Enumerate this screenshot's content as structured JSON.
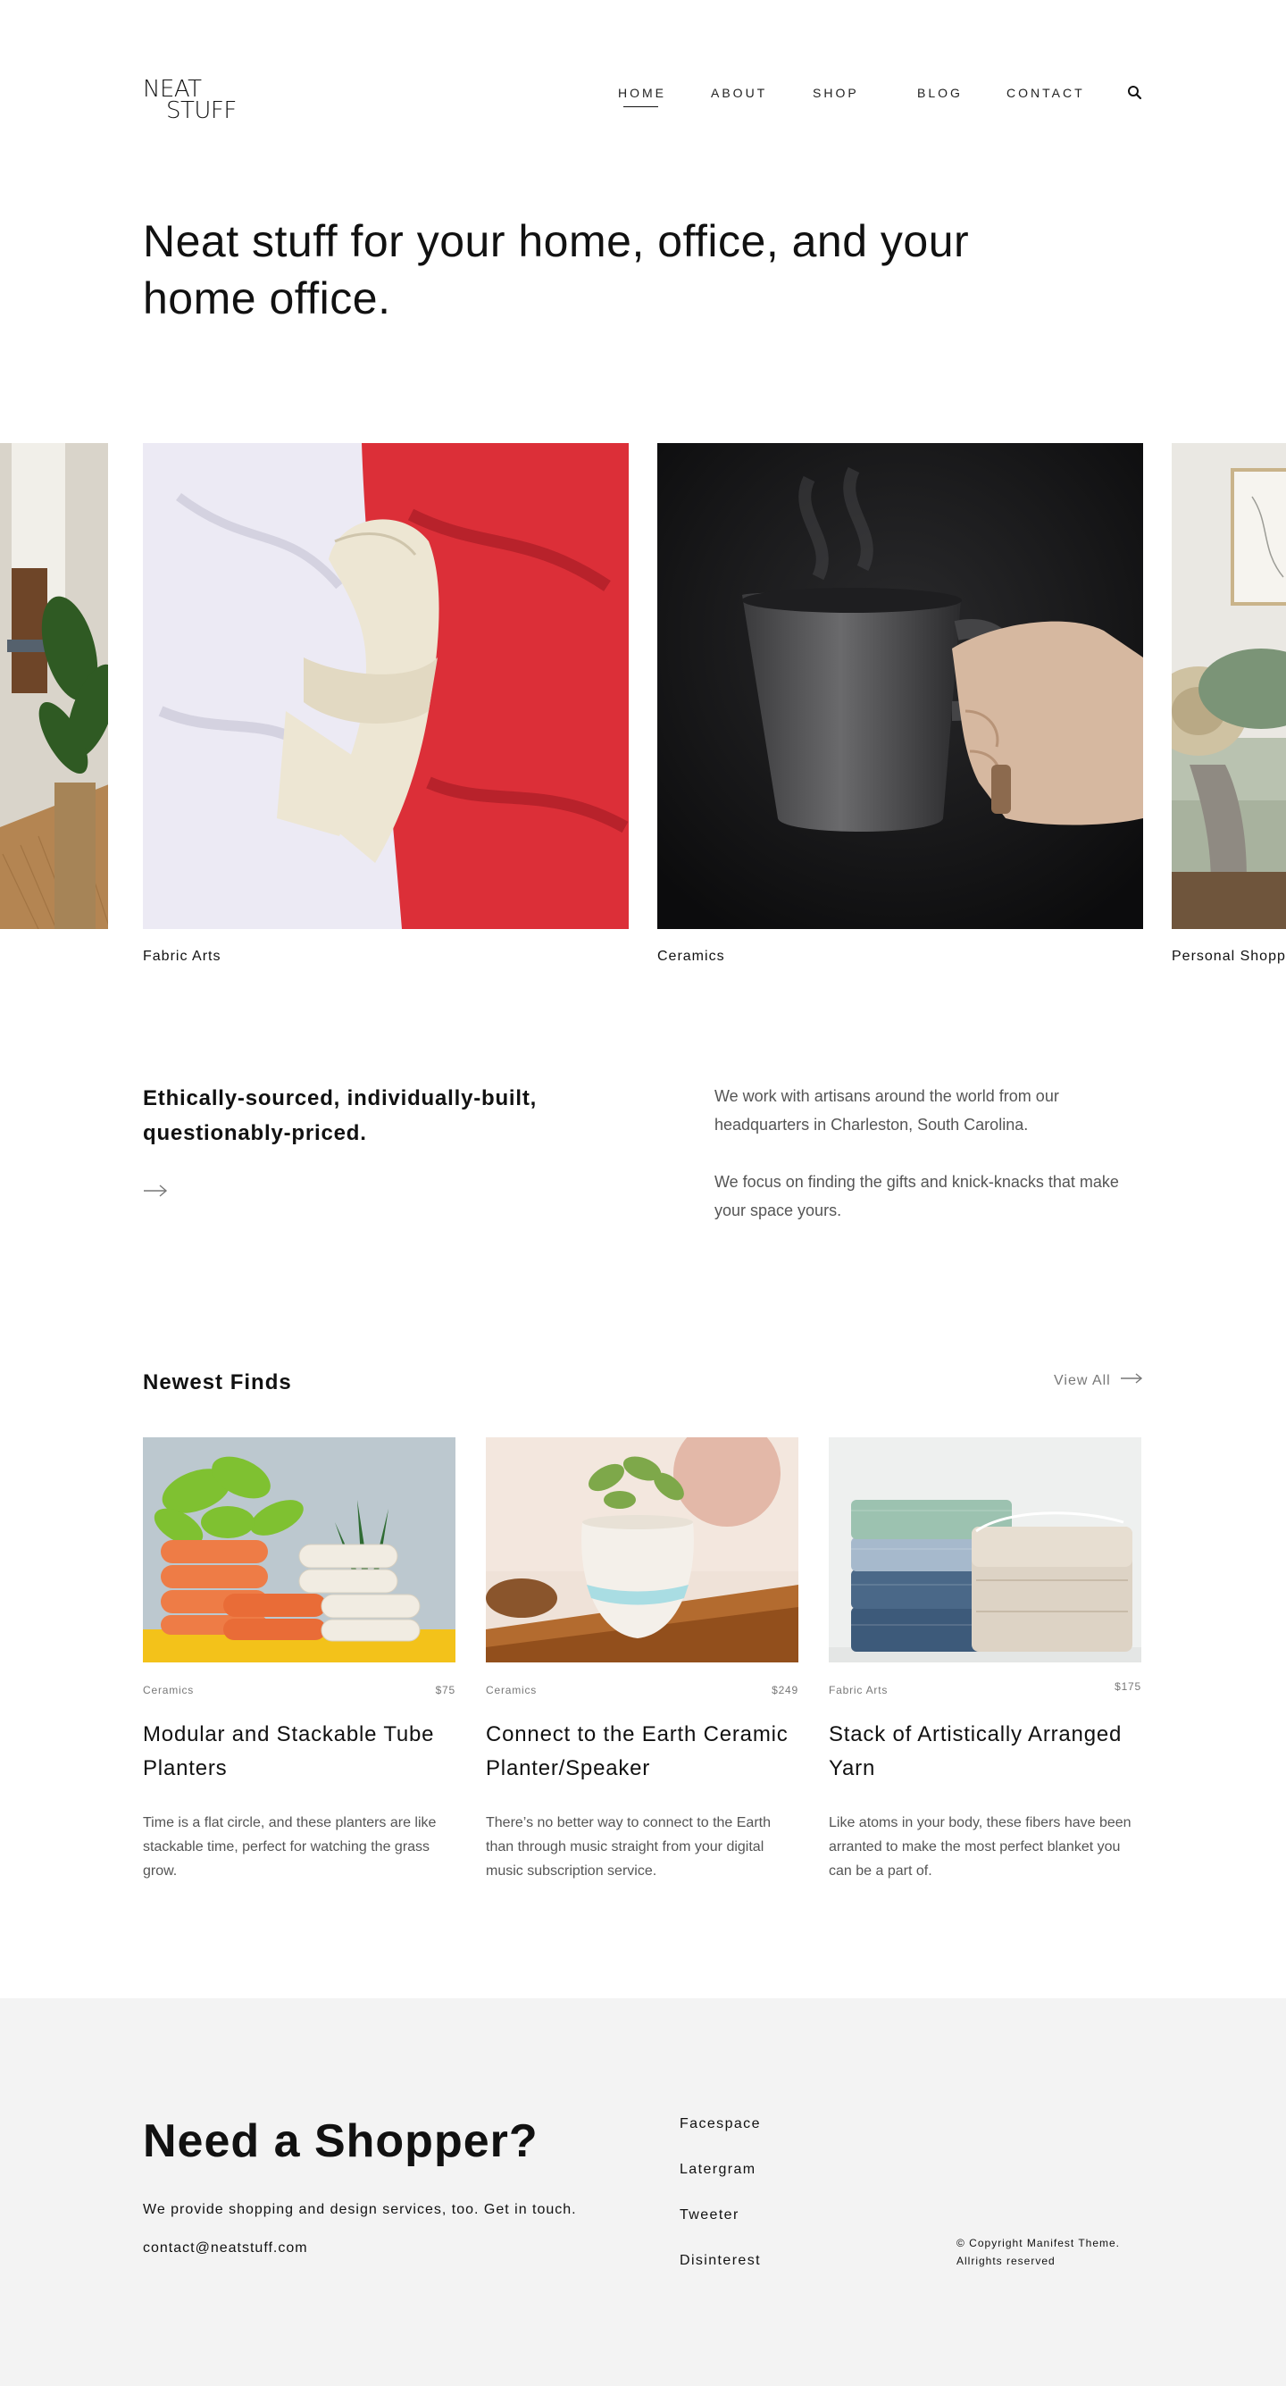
{
  "brand": {
    "logo_line1": "NEAT",
    "logo_line2": "STUFF"
  },
  "nav": {
    "items": [
      "HOME",
      "ABOUT",
      "SHOP",
      "BLOG",
      "CONTACT"
    ],
    "active": "HOME",
    "search_icon": "search-icon"
  },
  "hero": {
    "title": "Neat stuff for your home, office, and your home office."
  },
  "carousel": {
    "slides": [
      {
        "caption": "",
        "image": "interior-with-plant"
      },
      {
        "caption": "Fabric Arts",
        "image": "cream-scarf-on-red-and-white-fabric"
      },
      {
        "caption": "Ceramics",
        "image": "hand-holding-steaming-black-mug"
      },
      {
        "caption": "Personal Shopp",
        "image": "living-room-sofa-with-pillows"
      }
    ]
  },
  "intro": {
    "heading": "Ethically-sourced, individually-built, questionably-priced.",
    "arrow_icon": "arrow-right-icon",
    "paragraphs": [
      "We work with artisans around the world from our headquarters in Charleston, South Carolina.",
      "We focus on finding the gifts and knick-knacks that make your space yours."
    ]
  },
  "newest_finds": {
    "title": "Newest Finds",
    "view_all": "View All",
    "products": [
      {
        "category": "Ceramics",
        "price": "$75",
        "title": "Modular and Stackable Tube Planters",
        "description": "Time is a flat circle, and these planters are like stackable time, perfect for watching the grass grow."
      },
      {
        "category": "Ceramics",
        "price": "$249",
        "title": "Connect to the Earth Ceramic Planter/Speaker",
        "description": "There’s no better way to connect to the Earth than through music straight from your digital music subscription service."
      },
      {
        "category": "Fabric Arts",
        "price": "$175",
        "title": "Stack of Artistically Arranged Yarn",
        "description": "Like atoms in your body, these fibers have been arranted to make the most perfect blanket you can be a part of."
      }
    ]
  },
  "footer": {
    "title": "Need a Shopper?",
    "text": "We provide shopping and design services, too. Get in touch.",
    "email": "contact@neatstuff.com",
    "social": [
      "Facespace",
      "Latergram",
      "Tweeter",
      "Disinterest"
    ],
    "copyright_line1": "© Copyright Manifest Theme.",
    "copyright_line2": "Allrights reserved"
  },
  "colors": {
    "text": "#111111",
    "muted": "#777777",
    "body_text": "#555555",
    "footer_bg": "#f3f3f3",
    "accent_red": "#d8313a"
  }
}
